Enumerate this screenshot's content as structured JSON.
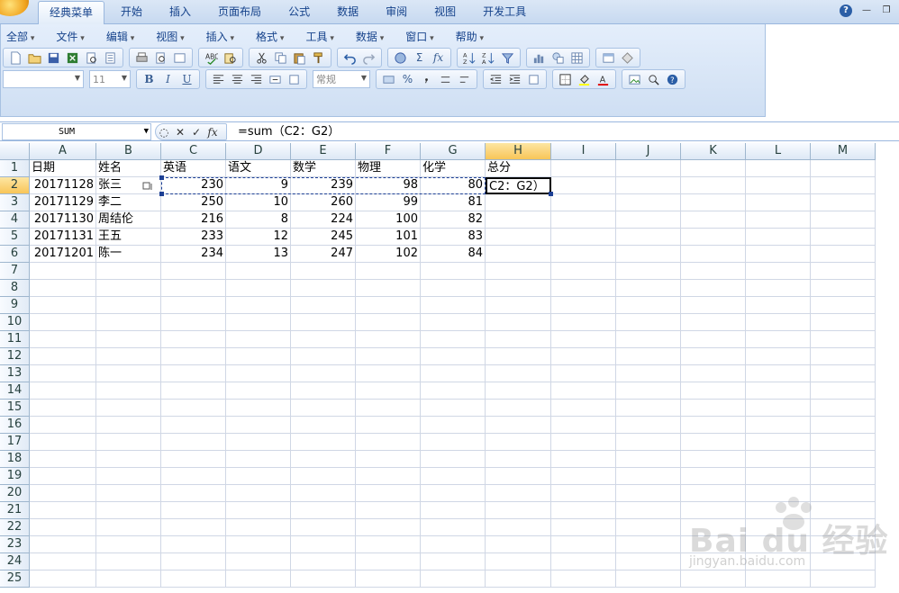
{
  "tabs": [
    "经典菜单",
    "开始",
    "插入",
    "页面布局",
    "公式",
    "数据",
    "审阅",
    "视图",
    "开发工具"
  ],
  "active_tab": 0,
  "menu": [
    "全部",
    "文件",
    "编辑",
    "视图",
    "插入",
    "格式",
    "工具",
    "数据",
    "窗口",
    "帮助"
  ],
  "toolbar": {
    "font_size": "11",
    "number_format": "常规",
    "bold": "B",
    "italic": "I",
    "underline": "U",
    "sigma": "Σ",
    "fx": "fx",
    "percent": "%"
  },
  "formula_bar": {
    "name_box": "SUM",
    "cancel": "✕",
    "enter": "✓",
    "fx": "fx",
    "formula": "=sum（C2：G2）"
  },
  "columns": [
    "A",
    "B",
    "C",
    "D",
    "E",
    "F",
    "G",
    "H",
    "I",
    "J",
    "K",
    "L",
    "M"
  ],
  "active_column": "H",
  "rows": [
    "1",
    "2",
    "3",
    "4",
    "5",
    "6",
    "7",
    "8",
    "9",
    "10",
    "11",
    "12",
    "13",
    "14",
    "15",
    "16",
    "17",
    "18",
    "19",
    "20",
    "21",
    "22",
    "23",
    "24",
    "25"
  ],
  "active_row": "2",
  "header_row": [
    "日期",
    "姓名",
    "英语",
    "语文",
    "数学",
    "物理",
    "化学",
    "总分"
  ],
  "data_rows": [
    [
      "20171128",
      "张三",
      "230",
      "9",
      "239",
      "98",
      "80",
      "C2：G2）"
    ],
    [
      "20171129",
      "李二",
      "250",
      "10",
      "260",
      "99",
      "81",
      ""
    ],
    [
      "20171130",
      "周结伦",
      "216",
      "8",
      "224",
      "100",
      "82",
      ""
    ],
    [
      "20171131",
      "王五",
      "233",
      "12",
      "245",
      "101",
      "83",
      ""
    ],
    [
      "20171201",
      "陈一",
      "234",
      "13",
      "247",
      "102",
      "84",
      ""
    ]
  ],
  "watermark": {
    "main": "Bai du 经验",
    "sub": "jingyan.baidu.com"
  }
}
